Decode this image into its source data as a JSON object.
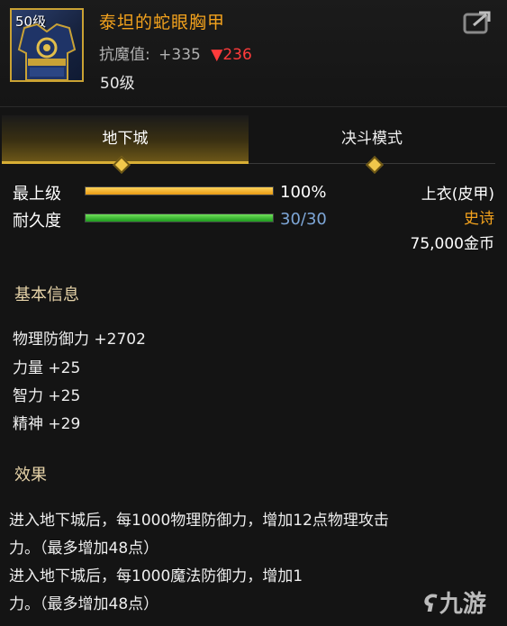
{
  "item": {
    "level_badge": "50级",
    "name": "泰坦的蛇眼胸甲",
    "resist_label": "抗魔值:",
    "resist_plus": "+335",
    "resist_down": "▼236",
    "level": "50级"
  },
  "tabs": [
    "地下城",
    "决斗模式"
  ],
  "stats": {
    "max_level_label": "最上级",
    "max_level_value": "100%",
    "max_level_fill": 1.0,
    "durability_label": "耐久度",
    "durability_value": "30/30",
    "durability_fill": 1.0
  },
  "info": {
    "slot": "上衣(皮甲)",
    "rarity": "史诗",
    "price": "75,000金币"
  },
  "basic": {
    "title": "基本信息",
    "lines": [
      "物理防御力 +2702",
      "力量 +25",
      "智力 +25",
      "精神 +29"
    ]
  },
  "effect": {
    "title": "效果",
    "lines": [
      "进入地下城后，每1000物理防御力，增加12点物理攻击",
      "力。（最多增加48点）",
      "进入地下城后，每1000魔法防御力，增加1",
      "力。（最多增加48点）"
    ]
  },
  "colors": {
    "name": "#f3a21d",
    "rarity": "#f3a21d",
    "down": "#ff3b3b",
    "durability_text": "#7ea7d8"
  },
  "watermark": "九游",
  "icons": [
    "share-icon",
    "armor-icon",
    "watermark-logo-icon"
  ]
}
